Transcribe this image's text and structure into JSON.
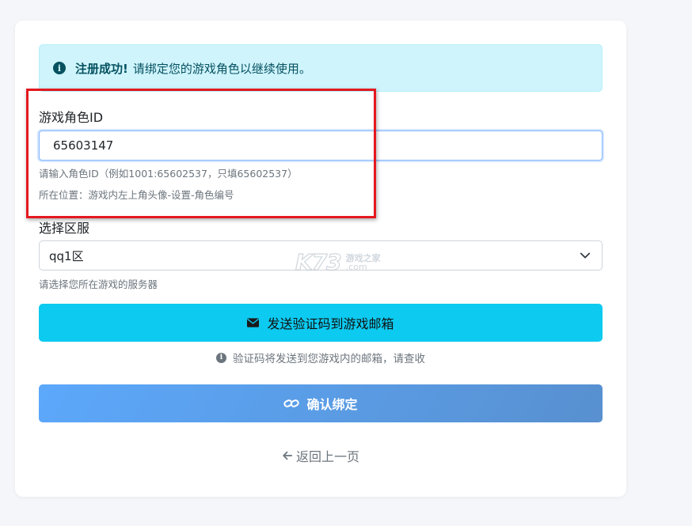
{
  "alert": {
    "icon": "info-icon",
    "title": "注册成功!",
    "message": "请绑定您的游戏角色以继续使用。"
  },
  "role_field": {
    "label": "游戏角色ID",
    "value": "65603147",
    "help1": "请输入角色ID（例如1001:65602537，只填65602537）",
    "help2": "所在位置：游戏内左上角头像-设置-角色编号"
  },
  "server_field": {
    "label": "选择区服",
    "selected": "qq1区",
    "help": "请选择您所在游戏的服务器"
  },
  "watermark": {
    "logo": "K73",
    "line1": "游戏之家",
    "line2": ".com"
  },
  "send_button": {
    "icon": "envelope-icon",
    "label": "发送验证码到游戏邮箱"
  },
  "send_note": "验证码将发送到您游戏内的邮箱，请查收",
  "confirm_button": {
    "icon": "link-icon",
    "label": "确认绑定"
  },
  "back_link": {
    "icon": "arrow-left-icon",
    "label": "返回上一页"
  },
  "colors": {
    "alert_bg": "#cff4fc",
    "send_button": "#0dcaf0",
    "confirm_button_start": "#5ca8fb",
    "confirm_button_end": "#5890d0",
    "highlight_border": "#e5181f"
  }
}
